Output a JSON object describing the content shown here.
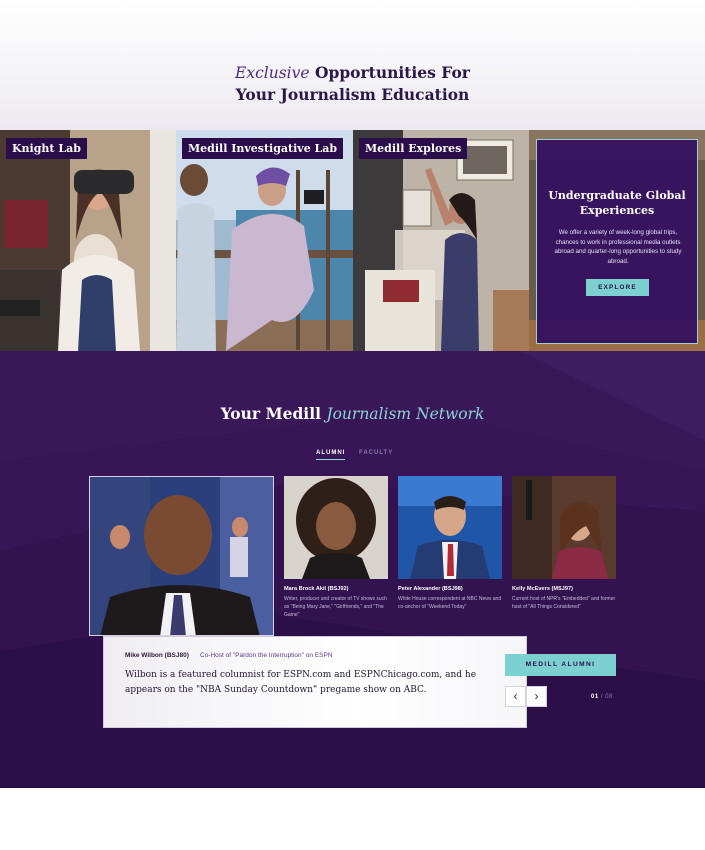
{
  "hero": {
    "title_em": "Exclusive",
    "title_line1_rest": "Opportunities For",
    "title_line2": "Your Journalism Education"
  },
  "opportunities": {
    "tiles": [
      {
        "label": "Knight Lab"
      },
      {
        "label": "Medill Investigative Lab"
      },
      {
        "label": "Medill Explores"
      }
    ],
    "card": {
      "title": "Undergraduate Global Experiences",
      "description": "We offer a variety of week-long global trips, chances to work in professional media outlets abroad and quarter-long opportunities to study abroad.",
      "button": "EXPLORE"
    }
  },
  "network": {
    "title_plain": "Your Medill",
    "title_em": "Journalism Network",
    "tabs": [
      {
        "label": "ALUMNI",
        "active": true
      },
      {
        "label": "FACULTY",
        "active": false
      }
    ],
    "people": [
      {
        "name": "Mara Brock Akil (BSJ92)",
        "desc": "Writer, producer and creator of TV shows such as \"Being Mary Jane,\" \"Girlfriends,\" and \"The Game\""
      },
      {
        "name": "Peter Alexander (BSJ98)",
        "desc": "White House correspondent at NBC News and co-anchor of \"Weekend Today\""
      },
      {
        "name": "Kelly McEvers (MSJ97)",
        "desc": "Current host of NPR's \"Embedded\" and former host of \"All Things Considered\""
      }
    ],
    "featured": {
      "name": "Mike Wilbon (BSJ80)",
      "role": "Co-Host of \"Pardon the Interruption\" on ESPN",
      "text": "Wilbon is a featured columnist for ESPN.com and ESPNChicago.com, and he appears on the \"NBA Sunday Countdown\" pregame show on ABC."
    },
    "cta": "MEDILL ALUMNI",
    "pager": {
      "current": "01",
      "total": "08",
      "separator": "/"
    },
    "arrows": {
      "prev": "‹",
      "next": "›"
    }
  },
  "colors": {
    "brand_purple": "#32124f",
    "accent_teal": "#7cd0cf"
  }
}
